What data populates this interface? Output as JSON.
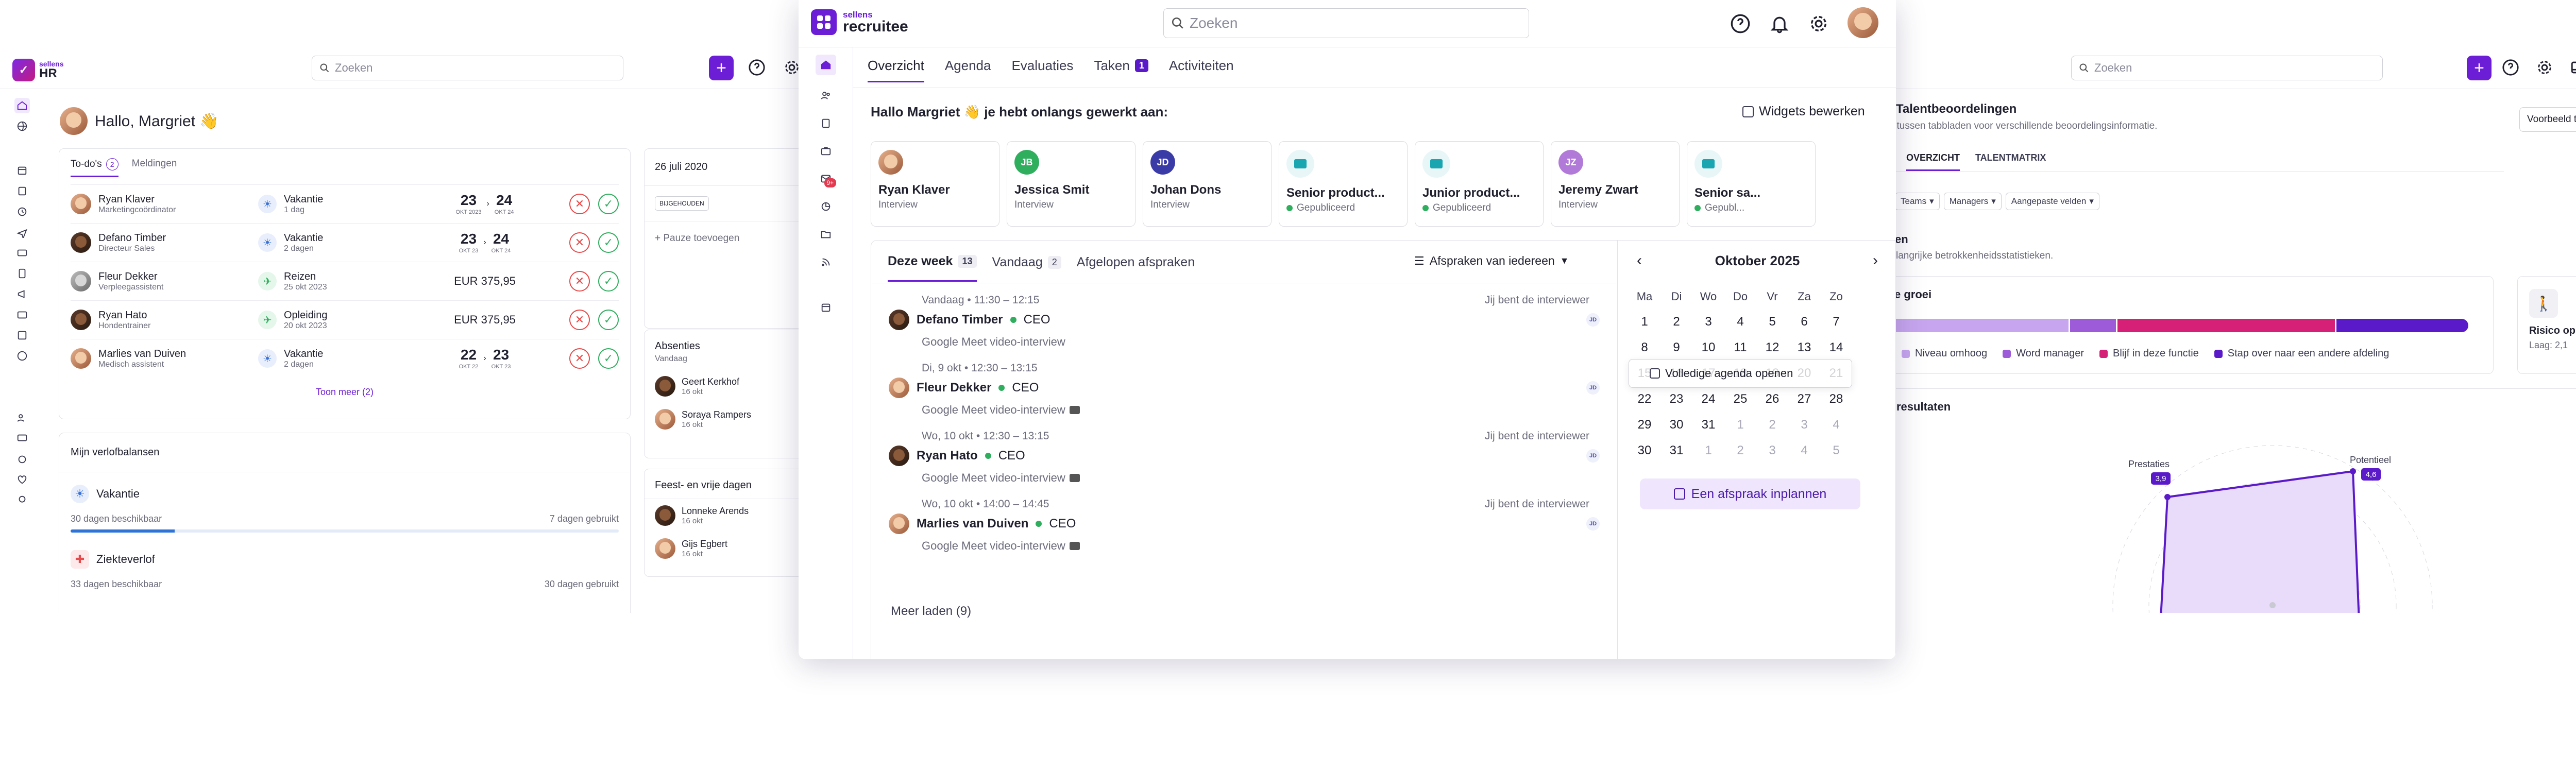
{
  "left": {
    "brand_top": "sellens",
    "brand_bottom": "HR",
    "search_placeholder": "Zoeken",
    "greeting": "Hallo, Margriet 👋",
    "tab_todo": "To-do's",
    "tab_todo_count": "2",
    "tab_notifications": "Meldingen",
    "rows": [
      {
        "name": "Ryan Klaver",
        "role": "Marketingcoördinator",
        "type": "Vakantie",
        "detail": "1 dag",
        "from": "23",
        "from_sub": "OKT 2023",
        "to": "24",
        "to_sub": "OKT 24"
      },
      {
        "name": "Defano Timber",
        "role": "Directeur Sales",
        "type": "Vakantie",
        "detail": "2 dagen",
        "from": "23",
        "from_sub": "OKT 23",
        "to": "24",
        "to_sub": "OKT 24"
      },
      {
        "name": "Fleur Dekker",
        "role": "Verpleegassistent",
        "type": "Reizen",
        "detail": "25 okt 2023",
        "amount": "EUR 375,95"
      },
      {
        "name": "Ryan Hato",
        "role": "Hondentrainer",
        "type": "Opleiding",
        "detail": "20 okt 2023",
        "amount": "EUR 375,95"
      },
      {
        "name": "Marlies van Duiven",
        "role": "Medisch assistent",
        "type": "Vakantie",
        "detail": "2 dagen",
        "from": "22",
        "from_sub": "OKT 22",
        "to": "23",
        "to_sub": "OKT 23"
      }
    ],
    "show_more": "Toon meer (2)",
    "leave_title": "Mijn verlofbalansen",
    "leave": [
      {
        "name": "Vakantie",
        "available": "30 dagen beschikbaar",
        "used": "7 dagen gebruikt",
        "progress": 0.19
      },
      {
        "name": "Ziekteverlof",
        "available": "33 dagen beschikbaar",
        "used": "30 dagen gebruikt"
      }
    ],
    "date_card_title": "26 juli 2020",
    "date_chip": "BIJGEHOUDEN",
    "add_pause": "+ Pauze toevoegen",
    "absence_title": "Absenties",
    "absence_sub": "Vandaag",
    "absences": [
      {
        "name": "Geert Kerkhof",
        "date": "16 okt"
      },
      {
        "name": "Soraya Rampers",
        "date": "16 okt"
      }
    ],
    "holidays_title": "Feest- en vrije dagen",
    "holidays": [
      {
        "name": "Lonneke Arends",
        "date": "16 okt"
      },
      {
        "name": "Gijs Egbert",
        "date": "16 okt"
      }
    ]
  },
  "center": {
    "brand_top": "sellens",
    "brand_bottom": "recruitee",
    "search_placeholder": "Zoeken",
    "tabs": [
      {
        "label": "Overzicht"
      },
      {
        "label": "Agenda"
      },
      {
        "label": "Evaluaties"
      },
      {
        "label": "Taken",
        "badge": "1"
      },
      {
        "label": "Activiteiten"
      }
    ],
    "mail_badge": "9+",
    "greeting": "Hallo Margriet 👋 je hebt onlangs gewerkt aan:",
    "edit_widgets": "Widgets bewerken",
    "cards": [
      {
        "name": "Ryan Klaver",
        "sub": "Interview"
      },
      {
        "name": "Jessica Smit",
        "sub": "Interview",
        "initials": "JB",
        "color": "#2fae5e"
      },
      {
        "name": "Johan Dons",
        "sub": "Interview",
        "initials": "JD",
        "color": "#3b3ba8"
      },
      {
        "name": "Senior product...",
        "sub": "Gepubliceerd"
      },
      {
        "name": "Junior product...",
        "sub": "Gepubliceerd"
      },
      {
        "name": "Jeremy Zwart",
        "sub": "Interview",
        "initials": "JZ",
        "color": "#b27ad8"
      },
      {
        "name": "Senior sa...",
        "sub": "Gepubl..."
      }
    ],
    "appt_tabs": [
      {
        "label": "Deze week",
        "count": "13"
      },
      {
        "label": "Vandaag",
        "count": "2"
      },
      {
        "label": "Afgelopen afspraken"
      }
    ],
    "filter": "Afspraken van iedereen",
    "appointments": [
      {
        "time": "Vandaag • 11:30 – 12:15",
        "note": "Jij bent de interviewer",
        "name": "Defano Timber",
        "role": "CEO",
        "meet": "Google Meet video-interview",
        "initials": "JD"
      },
      {
        "time": "Di, 9 okt • 12:30 – 13:15",
        "note": "",
        "name": "Fleur Dekker",
        "role": "CEO",
        "meet": "Google Meet video-interview",
        "initials": "JD"
      },
      {
        "time": "Wo, 10 okt • 12:30 – 13:15",
        "note": "Jij bent de interviewer",
        "name": "Ryan Hato",
        "role": "CEO",
        "meet": "Google Meet video-interview",
        "initials": "JD"
      },
      {
        "time": "Wo, 10 okt • 14:00 – 14:45",
        "note": "Jij bent de interviewer",
        "name": "Marlies van Duiven",
        "role": "CEO",
        "meet": "Google Meet video-interview",
        "initials": "JD"
      }
    ],
    "load_more": "Meer laden (9)",
    "calendar": {
      "month": "Oktober 2025",
      "days": [
        "Ma",
        "Di",
        "Wo",
        "Do",
        "Vr",
        "Za",
        "Zo"
      ],
      "weeks": [
        [
          "1",
          "2",
          "3",
          "4",
          "5",
          "6",
          "7"
        ],
        [
          "8",
          "9",
          "10",
          "11",
          "12",
          "13",
          "14"
        ],
        [
          "15",
          "16",
          "17",
          "18",
          "19",
          "20",
          "21"
        ],
        [
          "22",
          "23",
          "24",
          "25",
          "26",
          "27",
          "28"
        ],
        [
          "29",
          "30",
          "31",
          "1",
          "2",
          "3",
          "4"
        ],
        [
          "30",
          "31",
          "1",
          "2",
          "3",
          "4",
          "5"
        ]
      ],
      "tooltip": "Volledige agenda openen",
      "schedule": "Een afspraak inplannen"
    }
  },
  "right": {
    "search_placeholder": "Zoeken",
    "title": "Talentbeoordelingen",
    "subtitle": "l tussen tabbladen voor verschillende beoordelingsinformatie.",
    "template_button": "Voorbeeld template formulier",
    "tabs": [
      "OVERZICHT",
      "TALENTMATRIX"
    ],
    "filters": [
      "Teams",
      "Managers",
      "Aangepaste velden"
    ],
    "section": "en",
    "section_sub": "langrijke betrokkenheidsstatistieken.",
    "growth_title": "e groei",
    "growth_segments": [
      {
        "name": "Niveau omhoog",
        "value": 36,
        "color": "#c7a6ef"
      },
      {
        "name": "Word manager",
        "value": 9,
        "color": "#9d5ad9"
      },
      {
        "name": "Blijf in deze functie",
        "value": 43,
        "color": "#d61f77"
      },
      {
        "name": "Stap over naar een andere afdeling",
        "value": 26,
        "color": "#5b1ac9"
      }
    ],
    "risk_title": "Risico op vertrek",
    "risk_value": "Laag: 2,1",
    "results_title": "resultaten",
    "radar_labels": [
      {
        "label": "Prestaties",
        "value": "3,9"
      },
      {
        "label": "Potentieel",
        "value": "4,6"
      }
    ]
  }
}
